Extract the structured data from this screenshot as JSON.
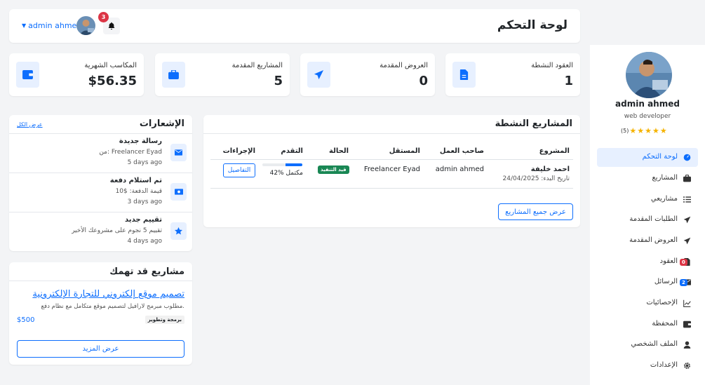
{
  "header": {
    "title": "لوحة التحكم",
    "user_name": "admin ahmed",
    "notification_count": "3"
  },
  "stats": [
    {
      "label": "العقود النشطة",
      "value": "1",
      "icon": "contract-file-icon"
    },
    {
      "label": "العروض المقدمة",
      "value": "0",
      "icon": "paper-plane-icon"
    },
    {
      "label": "المشاريع المقدمة",
      "value": "5",
      "icon": "briefcase-icon"
    },
    {
      "label": "المكاسب الشهرية",
      "value": "$56.35",
      "icon": "wallet-icon"
    }
  ],
  "notifications": {
    "title": "الإشعارات",
    "view_all": "عرض الكل",
    "items": [
      {
        "title": "رسالة جديدة",
        "desc": "من: Freelancer Eyad",
        "time": "5 days ago",
        "icon": "envelope-icon"
      },
      {
        "title": "تم استلام دفعة",
        "desc": "قيمة الدفعة: $10",
        "time": "3 days ago",
        "icon": "money-icon"
      },
      {
        "title": "تقييم جديد",
        "desc": "تقييم 5 نجوم على مشروعك الأخير",
        "time": "4 days ago",
        "icon": "star-icon"
      }
    ]
  },
  "active_projects": {
    "title": "المشاريع النشطة",
    "columns": [
      "المشروع",
      "صاحب العمل",
      "المستقل",
      "الحالة",
      "التقدم",
      "الإجراءات"
    ],
    "rows": [
      {
        "project": "احمد خليفة",
        "start_date": "تاريخ البدء: 24/04/2025",
        "client": "admin ahmed",
        "freelancer": "Freelancer Eyad",
        "status": "قيد التنفيذ",
        "progress": 42,
        "progress_label": "42% مكتمل",
        "action": "التفاصيل"
      }
    ],
    "view_all_button": "عرض جميع المشاريع"
  },
  "suggested": {
    "title": "مشاريع قد تهمك",
    "project_title": "تصميم موقع إلكتروني للتجارة الإلكترونية",
    "description": "مطلوب مبرمج لارافيل لتصميم موقع متكامل مع نظام دفع.",
    "tag": "برمجة وتطوير",
    "budget": "$500",
    "more_button": "عرض المزيد"
  },
  "sidebar": {
    "name": "admin ahmed",
    "role": "web developer",
    "rating_count": "(5)",
    "stars": 5,
    "items": [
      {
        "label": "لوحة التحكم",
        "icon": "dashboard-icon",
        "active": true
      },
      {
        "label": "المشاريع",
        "icon": "briefcase-icon"
      },
      {
        "label": "مشاريعي",
        "icon": "list-icon"
      },
      {
        "label": "الطلبات المقدمة",
        "icon": "paper-plane-icon"
      },
      {
        "label": "العروض المقدمة",
        "icon": "paper-plane-icon"
      },
      {
        "label": "العقود",
        "icon": "contract-file-icon",
        "badge": "0"
      },
      {
        "label": "الرسائل",
        "icon": "envelope-icon",
        "badge": "2"
      },
      {
        "label": "الإحصائيات",
        "icon": "chart-line-icon"
      },
      {
        "label": "المحفظة",
        "icon": "wallet-icon"
      },
      {
        "label": "الملف الشخصي",
        "icon": "user-icon"
      },
      {
        "label": "الإعدادات",
        "icon": "gear-icon"
      }
    ]
  },
  "colors": {
    "accent": "#0d6efd",
    "success": "#198754",
    "danger": "#dc3545",
    "star": "#f5b301"
  }
}
